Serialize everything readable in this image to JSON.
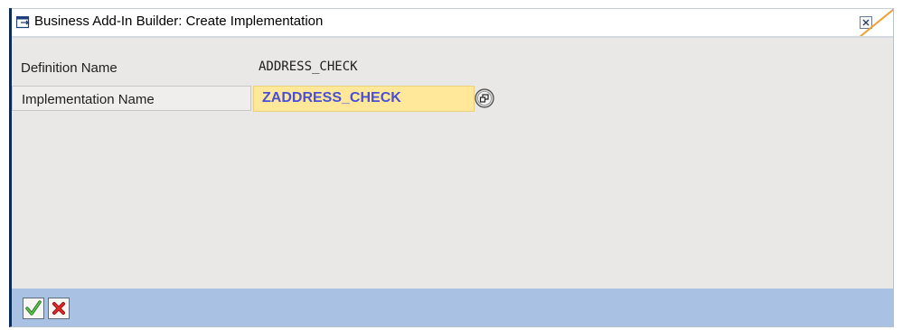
{
  "window": {
    "title": "Business Add-In Builder: Create Implementation",
    "icons": {
      "title": "dialog-window-icon",
      "close": "close-icon"
    }
  },
  "form": {
    "definition": {
      "label": "Definition Name",
      "value": "ADDRESS_CHECK"
    },
    "implementation": {
      "label": "Implementation Name",
      "value": "ZADDRESS_CHECK",
      "help_icon": "f4-value-help-icon"
    }
  },
  "footer": {
    "buttons": [
      {
        "icon": "checkmark-icon"
      },
      {
        "icon": "cancel-x-icon"
      }
    ]
  },
  "colors": {
    "dialog_background": "#e9e8e7",
    "footer_background": "#a9c2e4",
    "input_background": "#ffe89a",
    "input_text": "#4a4fd6",
    "accent_orange": "#f0a030",
    "ok_green": "#2e9a2e",
    "cancel_red": "#d21f1f"
  }
}
